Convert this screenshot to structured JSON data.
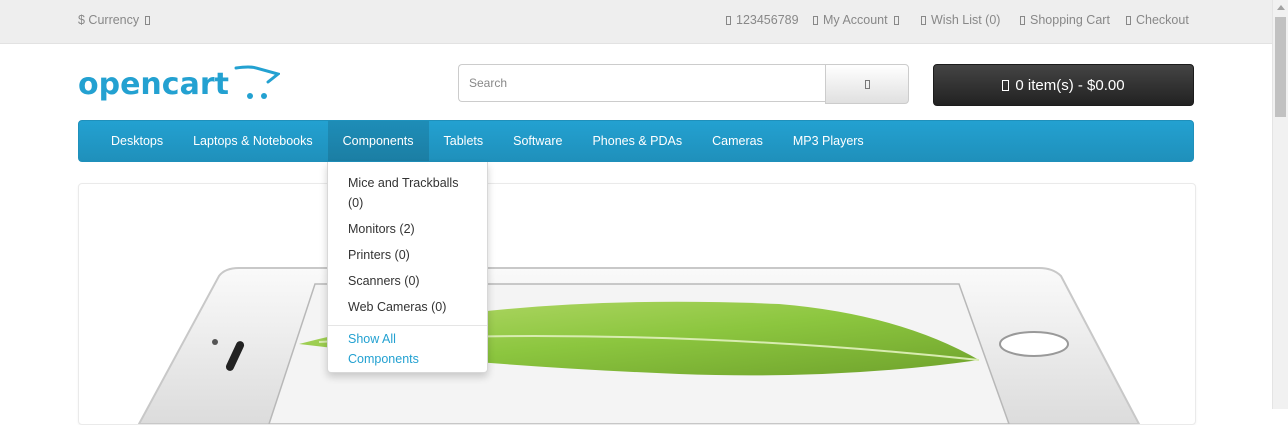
{
  "topbar": {
    "currency_label": "$ Currency",
    "phone": "123456789",
    "my_account": "My Account",
    "wish_list": "Wish List (0)",
    "shopping_cart": "Shopping Cart",
    "checkout": "Checkout"
  },
  "header": {
    "logo_text": "opencart",
    "search_placeholder": "Search",
    "search_icon": "search-icon",
    "cart_label": "0 item(s) - $0.00",
    "cart_icon": "shopping-cart-icon"
  },
  "menu": {
    "items": [
      {
        "label": "Desktops"
      },
      {
        "label": "Laptops & Notebooks"
      },
      {
        "label": "Components"
      },
      {
        "label": "Tablets"
      },
      {
        "label": "Software"
      },
      {
        "label": "Phones & PDAs"
      },
      {
        "label": "Cameras"
      },
      {
        "label": "MP3 Players"
      }
    ],
    "active_index": 2
  },
  "dropdown": {
    "items": [
      {
        "label": "Mice and Trackballs (0)"
      },
      {
        "label": "Monitors (2)"
      },
      {
        "label": "Printers (0)"
      },
      {
        "label": "Scanners (0)"
      },
      {
        "label": "Web Cameras (0)"
      }
    ],
    "show_all": "Show All Components"
  },
  "colors": {
    "brand_blue": "#23a1d1",
    "topbar_bg": "#eeeeee",
    "cart_dark": "#2b2b2b",
    "leaf_green": "#8cc63f"
  }
}
